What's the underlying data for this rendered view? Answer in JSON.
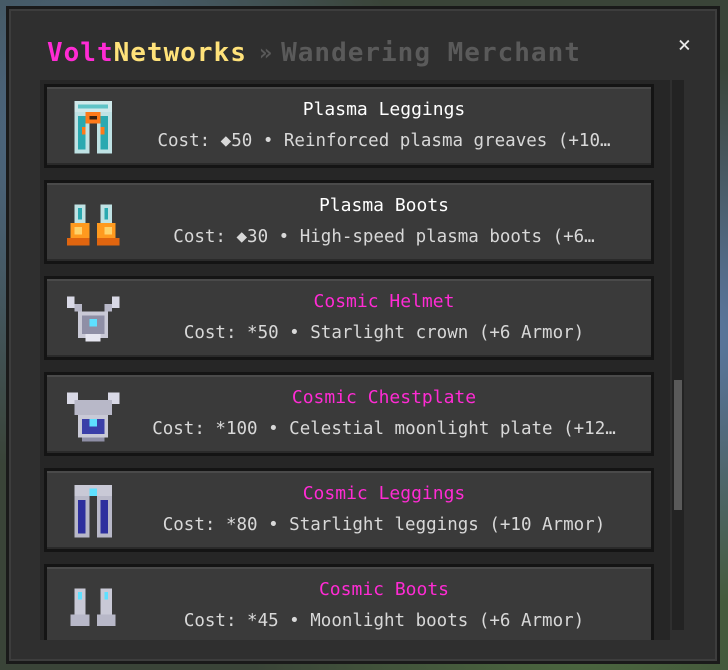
{
  "title": {
    "brand_part1": "Volt",
    "brand_part2": "Networks",
    "separator": "»",
    "page": "Wandering Merchant"
  },
  "close_label": "×",
  "colors": {
    "brand_pink": "#ff2bd4",
    "brand_yellow": "#ffe27a",
    "crumb_gray": "#5a5a5a",
    "cosmic_name": "#ff2bd4",
    "plasma_name": "#ffffff"
  },
  "items": [
    {
      "name": "Plasma Leggings",
      "desc": "Cost: ◆50 • Reinforced plasma greaves (+10…",
      "icon": "plasma-leggings-icon"
    },
    {
      "name": "Plasma Boots",
      "desc": "Cost: ◆30 • High-speed plasma boots (+6…",
      "icon": "plasma-boots-icon"
    },
    {
      "name": "Cosmic Helmet",
      "desc": "Cost: *50 • Starlight crown (+6 Armor)",
      "icon": "cosmic-helmet-icon"
    },
    {
      "name": "Cosmic Chestplate",
      "desc": "Cost: *100 • Celestial moonlight plate (+12…",
      "icon": "cosmic-chestplate-icon"
    },
    {
      "name": "Cosmic Leggings",
      "desc": "Cost: *80 • Starlight leggings (+10 Armor)",
      "icon": "cosmic-leggings-icon"
    },
    {
      "name": "Cosmic Boots",
      "desc": "Cost: *45 • Moonlight boots (+6 Armor)",
      "icon": "cosmic-boots-icon"
    }
  ]
}
